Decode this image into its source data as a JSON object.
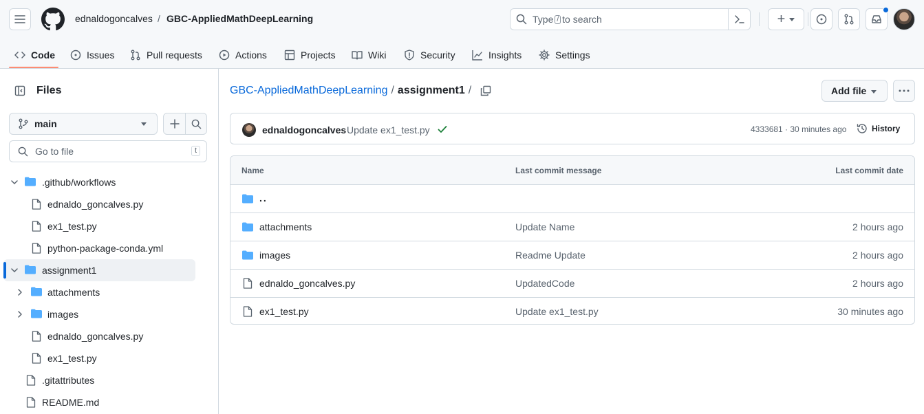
{
  "header": {
    "owner": "ednaldogoncalves",
    "separator": "/",
    "repo": "GBC-AppliedMathDeepLearning",
    "search_prefix": "Type",
    "search_key": "/",
    "search_suffix": "to search",
    "plus": "+"
  },
  "tabs": [
    {
      "label": "Code",
      "icon": "code-icon"
    },
    {
      "label": "Issues",
      "icon": "issue-icon"
    },
    {
      "label": "Pull requests",
      "icon": "pull-request-icon"
    },
    {
      "label": "Actions",
      "icon": "play-icon"
    },
    {
      "label": "Projects",
      "icon": "table-icon"
    },
    {
      "label": "Wiki",
      "icon": "book-icon"
    },
    {
      "label": "Security",
      "icon": "shield-icon"
    },
    {
      "label": "Insights",
      "icon": "graph-icon"
    },
    {
      "label": "Settings",
      "icon": "gear-icon"
    }
  ],
  "sidebar": {
    "title": "Files",
    "branch": "main",
    "goto_placeholder": "Go to file",
    "goto_key": "t",
    "tree": [
      {
        "name": ".github/workflows",
        "type": "folder",
        "expanded": true
      },
      {
        "name": "ednaldo_goncalves.py",
        "type": "file"
      },
      {
        "name": "ex1_test.py",
        "type": "file"
      },
      {
        "name": "python-package-conda.yml",
        "type": "file"
      },
      {
        "name": "assignment1",
        "type": "folder",
        "expanded": true,
        "selected": true
      },
      {
        "name": "attachments",
        "type": "folder",
        "expanded": false
      },
      {
        "name": "images",
        "type": "folder",
        "expanded": false
      },
      {
        "name": "ednaldo_goncalves.py",
        "type": "file"
      },
      {
        "name": "ex1_test.py",
        "type": "file"
      },
      {
        "name": ".gitattributes",
        "type": "file"
      },
      {
        "name": "README.md",
        "type": "file"
      }
    ]
  },
  "main": {
    "path_repo": "GBC-AppliedMathDeepLearning",
    "path_sep1": "/",
    "path_dir": "assignment1",
    "path_sep2": "/",
    "add_file": "Add file",
    "commit": {
      "author": "ednaldogoncalves",
      "message": "Update ex1_test.py",
      "meta": "4333681 · 30 minutes ago",
      "history": "History"
    },
    "table": {
      "headers": {
        "name": "Name",
        "message": "Last commit message",
        "date": "Last commit date"
      },
      "parent": "..",
      "rows": [
        {
          "name": "attachments",
          "type": "folder",
          "message": "Update Name",
          "date": "2 hours ago"
        },
        {
          "name": "images",
          "type": "folder",
          "message": "Readme Update",
          "date": "2 hours ago"
        },
        {
          "name": "ednaldo_goncalves.py",
          "type": "file",
          "message": "UpdatedCode",
          "date": "2 hours ago"
        },
        {
          "name": "ex1_test.py",
          "type": "file",
          "message": "Update ex1_test.py",
          "date": "30 minutes ago"
        }
      ]
    }
  },
  "colors": {
    "accent": "#0969da",
    "folder": "#54aeff",
    "tab_underline": "#fd8c73",
    "success": "#1a7f37",
    "notification": "#0969da"
  }
}
